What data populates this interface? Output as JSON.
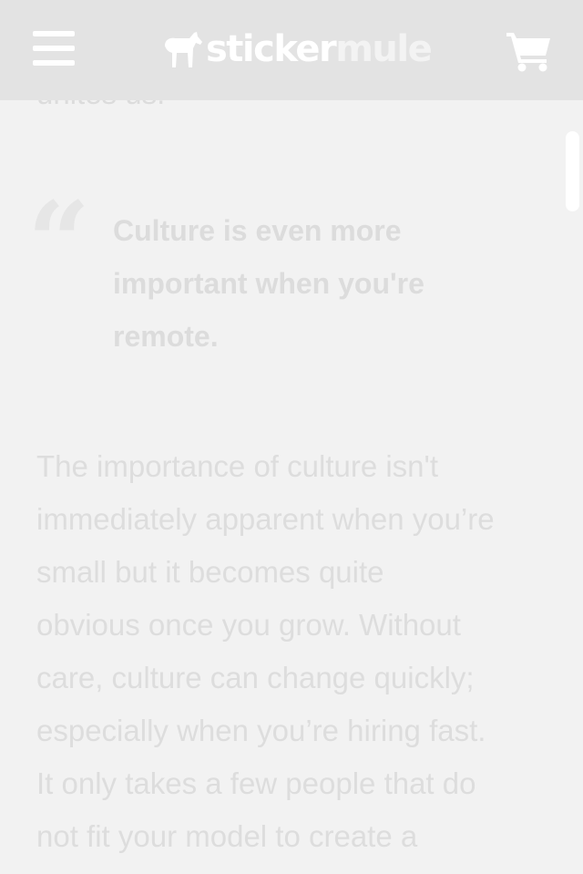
{
  "header": {
    "menu_icon": "hamburger-menu-icon",
    "logo": {
      "part1": "sticker",
      "part2": "mule",
      "icon": "mule-logo-icon"
    },
    "cart_icon": "shopping-cart-icon"
  },
  "article": {
    "cut_line": "unites us.",
    "pull_quote": "Culture is even more important when you're remote.",
    "paragraph_lines": [
      "The importance of culture isn't",
      "immediately apparent when you’re",
      "small but it becomes quite",
      "obvious once you grow. Without",
      "care, culture can change quickly;",
      "especially when you’re hiring fast.",
      "It only takes a few people that do",
      "not fit your model to create a"
    ]
  },
  "colors": {
    "header_bg": "#e3e3e3",
    "page_bg": "#f2f2f2",
    "text_faded": "#dddddd",
    "icon_white": "#ffffff"
  }
}
